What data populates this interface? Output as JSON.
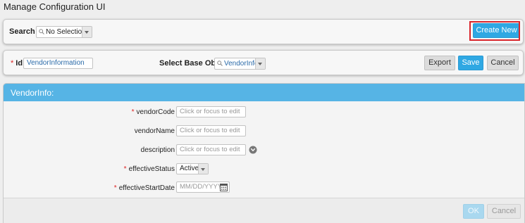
{
  "page_title": "Manage Configuration UI",
  "search": {
    "label": "Search :",
    "value": "No Selection",
    "icon": "search-icon"
  },
  "toolbar": {
    "create_new_label": "Create New"
  },
  "object": {
    "id_label": "Id",
    "id_value": "VendorInformation",
    "base_object_label": "Select Base Object",
    "base_object_value": "VendorInfo",
    "export_label": "Export",
    "save_label": "Save",
    "cancel_label": "Cancel"
  },
  "form": {
    "title": "VendorInfo:",
    "fields": [
      {
        "label": "vendorCode",
        "required": true,
        "placeholder": "Click or focus to edit"
      },
      {
        "label": "vendorName",
        "required": false,
        "placeholder": "Click or focus to edit"
      },
      {
        "label": "description",
        "required": false,
        "placeholder": "Click or focus to edit"
      },
      {
        "label": "effectiveStatus",
        "required": true,
        "value": "Active"
      },
      {
        "label": "effectiveStartDate",
        "required": true,
        "placeholder": "MM/DD/YYYY"
      }
    ],
    "ok_label": "OK",
    "cancel_label": "Cancel"
  },
  "colors": {
    "accent": "#2fa8e3",
    "header": "#56b4e5",
    "required": "#dd2222",
    "highlight": "#d9262c"
  }
}
